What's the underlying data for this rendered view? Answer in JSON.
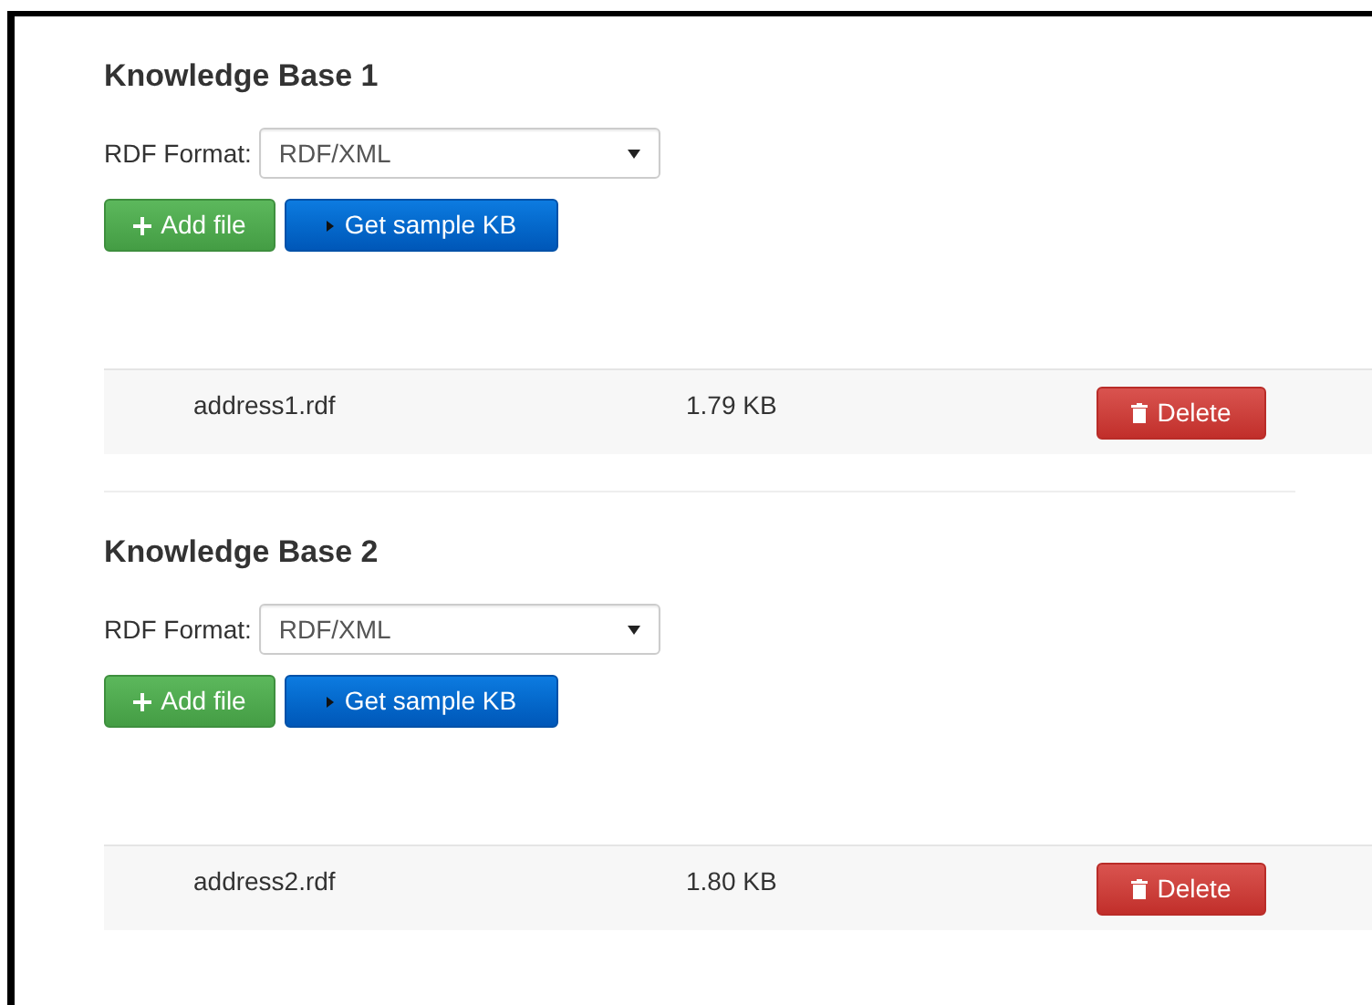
{
  "knowledge_bases": [
    {
      "title": "Knowledge Base 1",
      "format_label": "RDF Format:",
      "format_value": "RDF/XML",
      "add_button": "Add file",
      "sample_button": "Get sample KB",
      "files": [
        {
          "name": "address1.rdf",
          "size": "1.79 KB",
          "delete_button": "Delete"
        }
      ]
    },
    {
      "title": "Knowledge Base 2",
      "format_label": "RDF Format:",
      "format_value": "RDF/XML",
      "add_button": "Add file",
      "sample_button": "Get sample KB",
      "files": [
        {
          "name": "address2.rdf",
          "size": "1.80 KB",
          "delete_button": "Delete"
        }
      ]
    }
  ]
}
